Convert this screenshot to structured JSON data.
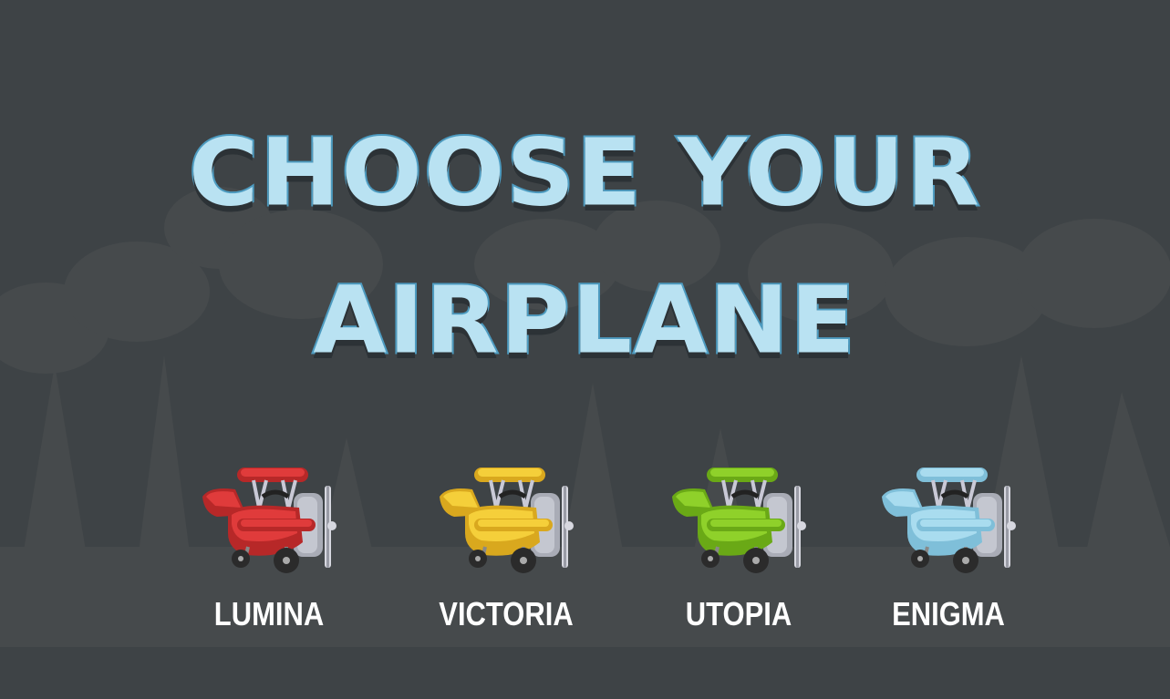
{
  "title": {
    "line1": "CHOOSE YOUR",
    "line2": "AIRPLANE"
  },
  "planes": [
    {
      "name": "LUMINA",
      "icon": "red-biplane-icon",
      "color": "#e03b3b",
      "dark": "#b72828"
    },
    {
      "name": "VICTORIA",
      "icon": "yellow-biplane-icon",
      "color": "#f5cf3a",
      "dark": "#d9a81e"
    },
    {
      "name": "UTOPIA",
      "icon": "green-biplane-icon",
      "color": "#8fd12a",
      "dark": "#6aa916"
    },
    {
      "name": "ENIGMA",
      "icon": "blue-biplane-icon",
      "color": "#a9dcef",
      "dark": "#7fbfd9"
    }
  ],
  "colors": {
    "background": "#3e4346",
    "silhouette": "#474b4d",
    "title_fill": "#b9e2f2",
    "title_stroke": "#4d9bc0"
  }
}
